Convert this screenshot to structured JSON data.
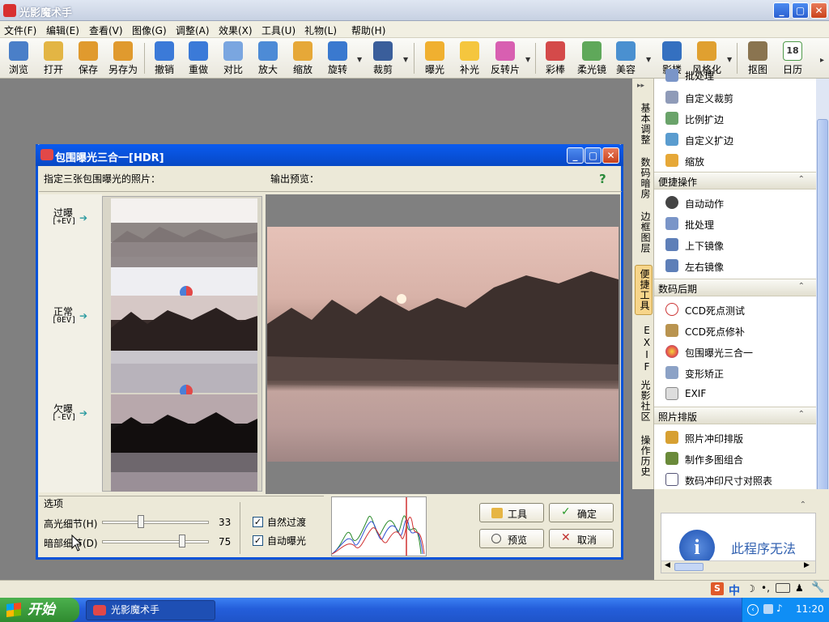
{
  "app": {
    "title": "光影魔术手",
    "window_buttons": {
      "minimize": "_",
      "maximize": "▢",
      "close": "✕"
    }
  },
  "menu": [
    "文件(F)",
    "编辑(E)",
    "查看(V)",
    "图像(G)",
    "调整(A)",
    "效果(X)",
    "工具(U)",
    "礼物(L)",
    "帮助(H)"
  ],
  "toolbar": [
    {
      "label": "浏览",
      "color": "#4a7fc8"
    },
    {
      "label": "打开",
      "color": "#e3b544"
    },
    {
      "label": "保存",
      "color": "#e09a2e"
    },
    {
      "label": "另存为",
      "color": "#e09a2e"
    },
    {
      "label": "撤销",
      "color": "#3b7ad8"
    },
    {
      "label": "重做",
      "color": "#3b7ad8"
    },
    {
      "label": "对比",
      "color": "#7aa6e0"
    },
    {
      "label": "放大",
      "color": "#4d8bd6"
    },
    {
      "label": "缩放",
      "color": "#e6a838"
    },
    {
      "label": "旋转",
      "color": "#3a79cf"
    },
    {
      "label": "裁剪",
      "color": "#3a5e9b"
    },
    {
      "label": "曝光",
      "color": "#f0b030"
    },
    {
      "label": "补光",
      "color": "#f5c63e"
    },
    {
      "label": "反转片",
      "color": "#d85fb1"
    },
    {
      "label": "彩棒",
      "color": "#d44a4a"
    },
    {
      "label": "柔光镜",
      "color": "#5fa85a"
    },
    {
      "label": "美容",
      "color": "#4a90d0"
    },
    {
      "label": "影楼",
      "color": "#3470c0"
    },
    {
      "label": "风格化",
      "color": "#e0a030"
    },
    {
      "label": "抠图",
      "color": "#8a7450"
    },
    {
      "label": "日历",
      "color": "#4f9a4a"
    }
  ],
  "calendar_day": "18",
  "side_tabs": [
    "基本调整",
    "数码暗房",
    "边框图层",
    "便捷工具",
    "EXIF",
    "光影社区",
    "操作历史"
  ],
  "right_panel": {
    "top_cut": "批处理",
    "items_a": [
      "自定义裁剪",
      "比例扩边",
      "自定义扩边",
      "缩放"
    ],
    "section1": "便捷操作",
    "items_b": [
      "自动动作",
      "批处理",
      "上下镜像",
      "左右镜像"
    ],
    "section2": "数码后期",
    "items_c": [
      "CCD死点测试",
      "CCD死点修补",
      "包围曝光三合一",
      "变形矫正",
      "EXIF"
    ],
    "section3": "照片排版",
    "items_d": [
      "照片冲印排版",
      "制作多图组合",
      "数码冲印尺寸对照表"
    ]
  },
  "message": "此程序无法",
  "dialog": {
    "title": "包围曝光三合一[HDR]",
    "src_label": "指定三张包围曝光的照片：",
    "out_label": "输出预览：",
    "help": "?",
    "over": "过曝",
    "over_ev": "[+EV]",
    "normal": "正常",
    "normal_ev": "[0EV]",
    "under": "欠曝",
    "under_ev": "[-EV]",
    "options": "选项",
    "highlight_label": "高光细节(H)",
    "highlight_value": "33",
    "highlight_fraction": 0.36,
    "shadow_label": "暗部细节(D)",
    "shadow_value": "75",
    "shadow_fraction": 0.75,
    "natural": "自然过渡",
    "auto_exposure": "自动曝光",
    "btn_tools": "工具",
    "btn_ok": "确定",
    "btn_preview": "预览",
    "btn_cancel": "取消"
  },
  "taskbar": {
    "start": "开始",
    "app": "光影魔术手",
    "time": "11:20"
  }
}
